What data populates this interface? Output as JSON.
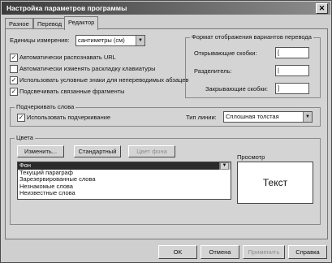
{
  "window": {
    "title": "Настройка параметров программы",
    "close_glyph": "✕"
  },
  "tabs": [
    {
      "label": "Разное"
    },
    {
      "label": "Перевод"
    },
    {
      "label": "Редактор"
    }
  ],
  "editor": {
    "units_label": "Единицы измерения:",
    "units_value": "сантиметры (см)",
    "checkboxes": [
      {
        "label": "Автоматически распознавать URL",
        "checked": true,
        "mark": "✓"
      },
      {
        "label": "Автоматически изменять раскладку клавиатуры",
        "checked": false,
        "mark": ""
      },
      {
        "label": "Использовать условные знаки для непереводимых абзацев",
        "checked": true,
        "mark": "✓"
      },
      {
        "label": "Подсвечивать связанные фрагменты",
        "checked": true,
        "mark": "✓"
      }
    ]
  },
  "format_group": {
    "title": "Формат отображения вариантов перевода",
    "open_label": "Открывающие скобки:",
    "open_value": "[",
    "sep_label": "Разделитель:",
    "sep_value": "|",
    "close_label": "Закрывающие скобки:",
    "close_value": "]"
  },
  "underline_group": {
    "title": "Подчеркивать слова",
    "checkbox_label": "Использовать подчеркивание",
    "checkbox_mark": "✓",
    "line_type_label": "Тип линии:",
    "line_type_value": "Сплошная толстая"
  },
  "colors_group": {
    "title": "Цвета",
    "btn_change": "Изменить...",
    "btn_standard": "Стандартный",
    "btn_bg_color": "Цвет фона",
    "list_items": [
      "Фон",
      "Текущий параграф",
      "Зарезервированные слова",
      "Незнакомые слова",
      "Неизвестные слова"
    ],
    "preview_label": "Просмотр",
    "preview_text": "Текст"
  },
  "footer": {
    "ok": "OK",
    "cancel": "Отмена",
    "apply": "Применить",
    "help": "Справка"
  }
}
